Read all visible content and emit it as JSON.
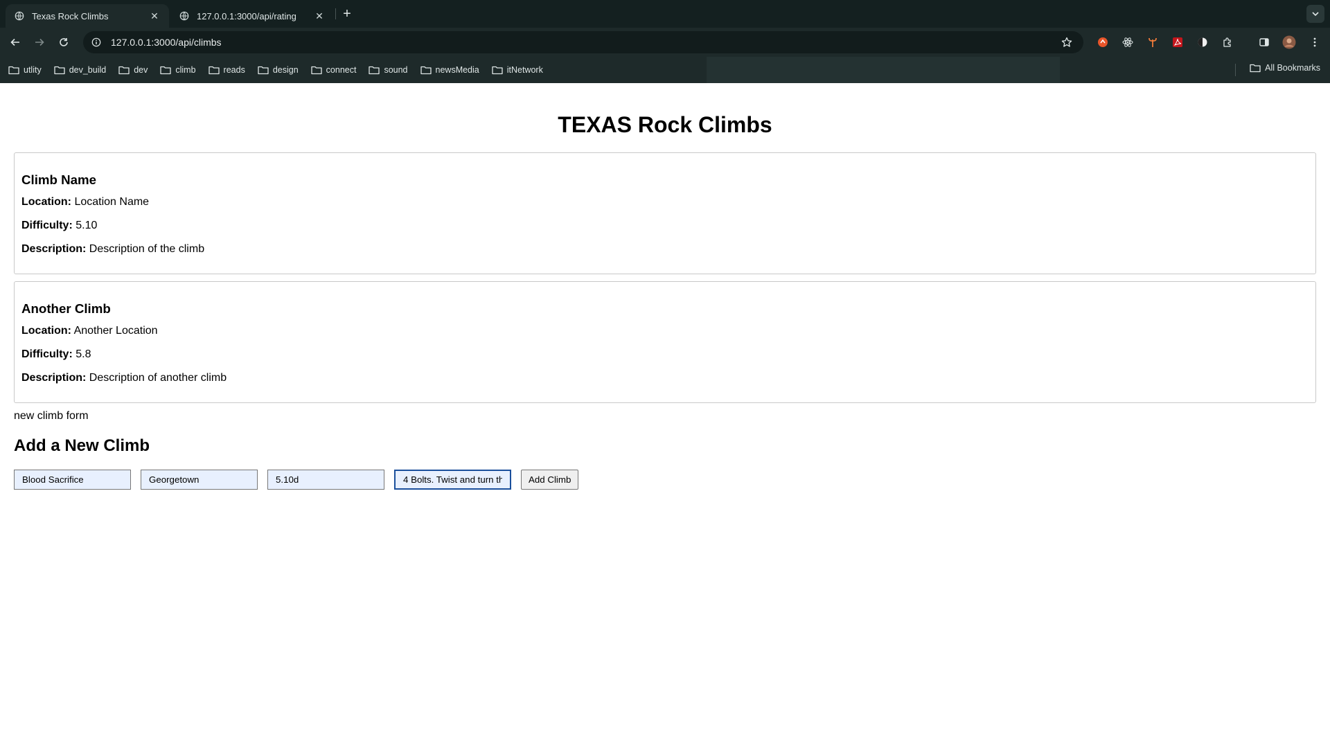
{
  "browser": {
    "tabs": [
      {
        "title": "Texas Rock Climbs",
        "active": true
      },
      {
        "title": "127.0.0.1:3000/api/rating",
        "active": false
      }
    ],
    "url": "127.0.0.1:3000/api/climbs",
    "bookmarks": [
      "utlity",
      "dev_build",
      "dev",
      "climb",
      "reads",
      "design",
      "connect",
      "sound",
      "newsMedia",
      "itNetwork"
    ],
    "all_bookmarks_label": "All Bookmarks",
    "extensions": [
      "orange-extension-icon",
      "react-devtools-icon",
      "pitchfork-extension-icon",
      "pdf-extension-icon",
      "dark-mode-icon",
      "puzzle-extensions-icon"
    ]
  },
  "page": {
    "title": "TEXAS Rock Climbs",
    "climbs": [
      {
        "name": "Climb Name",
        "location_label": "Location:",
        "location": "Location Name",
        "difficulty_label": "Difficulty:",
        "difficulty": "5.10",
        "description_label": "Description:",
        "description": "Description of the climb"
      },
      {
        "name": "Another Climb",
        "location_label": "Location:",
        "location": "Another Location",
        "difficulty_label": "Difficulty:",
        "difficulty": "5.8",
        "description_label": "Description:",
        "description": "Description of another climb"
      }
    ],
    "form_note": "new climb form",
    "form_title": "Add a New Climb",
    "form": {
      "name_value": "Blood Sacrifice",
      "location_value": "Georgetown",
      "difficulty_value": "5.10d",
      "description_value": "4 Bolts. Twist and turn th",
      "submit_label": "Add Climb"
    }
  }
}
